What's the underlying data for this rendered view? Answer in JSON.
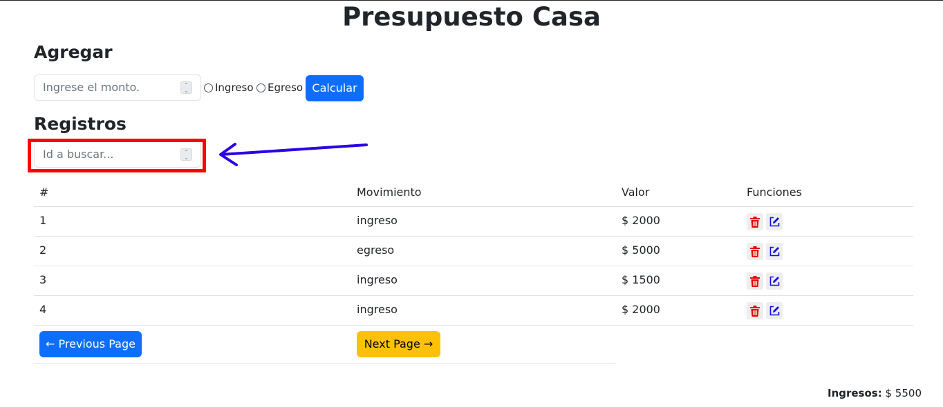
{
  "header": {
    "title": "Presupuesto Casa"
  },
  "agregar": {
    "title": "Agregar",
    "amount_placeholder": "Ingrese el monto.",
    "radio_ingreso": "Ingreso",
    "radio_egreso": "Egreso",
    "calcular_label": "Calcular"
  },
  "registros": {
    "title": "Registros",
    "search_placeholder": "Id a buscar..."
  },
  "table": {
    "headers": {
      "id": "#",
      "movimiento": "Movimiento",
      "valor": "Valor",
      "funciones": "Funciones"
    },
    "rows": [
      {
        "id": "1",
        "movimiento": "ingreso",
        "valor": "$ 2000"
      },
      {
        "id": "2",
        "movimiento": "egreso",
        "valor": "$ 5000"
      },
      {
        "id": "3",
        "movimiento": "ingreso",
        "valor": "$ 1500"
      },
      {
        "id": "4",
        "movimiento": "ingreso",
        "valor": "$ 2000"
      }
    ]
  },
  "pagination": {
    "prev_label": "← Previous Page",
    "next_label": "Next Page →"
  },
  "totals": {
    "ingresos_label": "Ingresos:",
    "ingresos_value": "$ 5500"
  },
  "icons": {
    "delete": "trash-icon",
    "edit": "edit-icon"
  },
  "colors": {
    "primary": "#0d6efd",
    "warning": "#ffc107",
    "delete": "#e30000",
    "edit": "#1010e0",
    "highlight": "#ff0000",
    "arrow": "#2b00e8"
  }
}
